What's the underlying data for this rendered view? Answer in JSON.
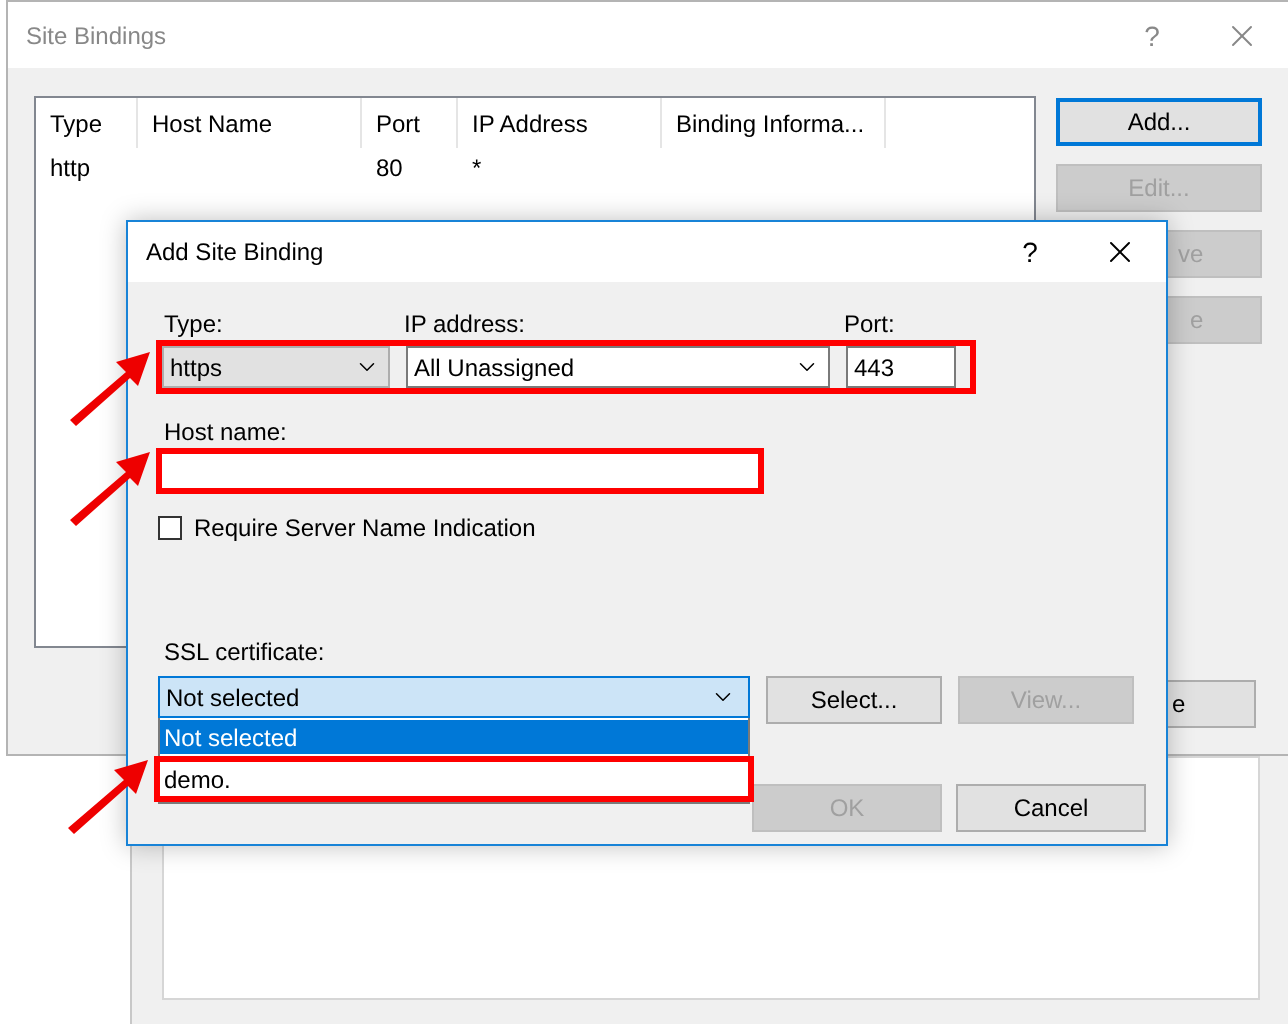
{
  "site_bindings": {
    "title": "Site Bindings",
    "help": "?",
    "columns": [
      "Type",
      "Host Name",
      "Port",
      "IP Address",
      "Binding Informa..."
    ],
    "rows": [
      [
        "http",
        "",
        "80",
        "*",
        ""
      ]
    ],
    "buttons": [
      {
        "label": "Add...",
        "disabled": false,
        "focused": true
      },
      {
        "label": "Edit...",
        "disabled": true,
        "focused": false
      },
      {
        "label": "ve",
        "disabled": true,
        "focused": false
      },
      {
        "label": "e",
        "disabled": true,
        "focused": false
      }
    ],
    "close_button": {
      "label": "e",
      "disabled": false
    }
  },
  "dialog": {
    "title": "Add Site Binding",
    "help": "?",
    "binding_row": {
      "highlighted": true,
      "type": {
        "label": "Type:",
        "value": "https"
      },
      "ip_address": {
        "label": "IP address:",
        "value": "All Unassigned"
      },
      "port": {
        "label": "Port:",
        "value": "443"
      }
    },
    "host_name": {
      "label": "Host name:",
      "highlighted": true
    },
    "sni": {
      "label": "Require Server Name Indication",
      "checked": false
    },
    "ssl_certificate": {
      "label": "SSL certificate:",
      "value": "Not selected",
      "options": [
        {
          "label": "Not selected",
          "selected": true,
          "highlighted": false
        },
        {
          "label": "demo.",
          "selected": false,
          "highlighted": true
        }
      ]
    },
    "side_buttons": [
      {
        "label": "Select...",
        "disabled": false
      },
      {
        "label": "View...",
        "disabled": true
      }
    ],
    "buttons": [
      {
        "label": "OK",
        "disabled": true
      },
      {
        "label": "Cancel",
        "disabled": false
      }
    ]
  }
}
